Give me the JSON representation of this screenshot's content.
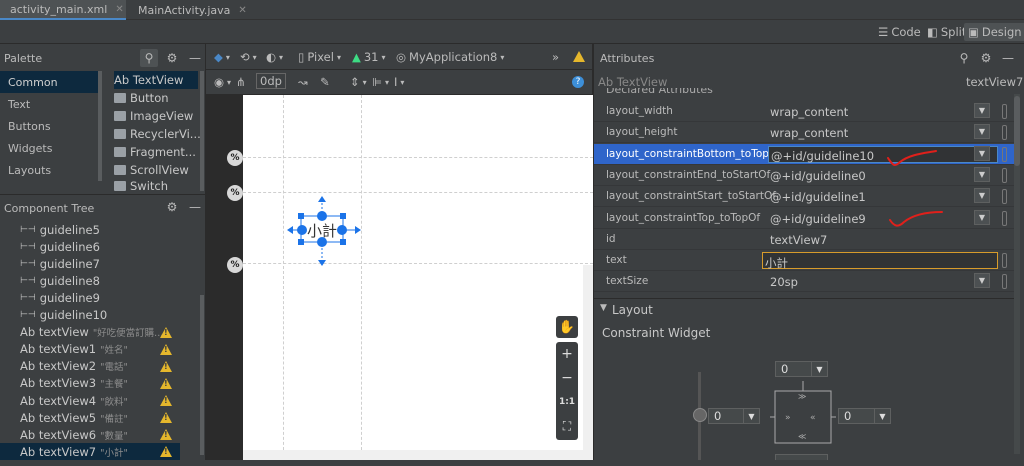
{
  "tabs": [
    {
      "label": "activity_main.xml",
      "active": true
    },
    {
      "label": "MainActivity.java",
      "active": false
    }
  ],
  "view_modes": [
    {
      "label": "Code"
    },
    {
      "label": "Split"
    },
    {
      "label": "Design",
      "active": true
    }
  ],
  "palette": {
    "title": "Palette",
    "categories": [
      "Common",
      "Text",
      "Buttons",
      "Widgets",
      "Layouts"
    ],
    "items": [
      "Ab TextView",
      "Button",
      "ImageView",
      "RecyclerVi...",
      "Fragment...",
      "ScrollView",
      "Switch"
    ]
  },
  "component_tree": {
    "title": "Component Tree",
    "items": [
      {
        "label": "guideline5",
        "sub": ""
      },
      {
        "label": "guideline6",
        "sub": ""
      },
      {
        "label": "guideline7",
        "sub": ""
      },
      {
        "label": "guideline8",
        "sub": ""
      },
      {
        "label": "guideline9",
        "sub": ""
      },
      {
        "label": "guideline10",
        "sub": ""
      },
      {
        "label": "Ab textView",
        "sub": "\"好吃便當訂購...",
        "warn": true
      },
      {
        "label": "Ab textView1",
        "sub": "\"姓名\"",
        "warn": true
      },
      {
        "label": "Ab textView2",
        "sub": "\"電話\"",
        "warn": true
      },
      {
        "label": "Ab textView3",
        "sub": "\"主餐\"",
        "warn": true
      },
      {
        "label": "Ab textView4",
        "sub": "\"飲料\"",
        "warn": true
      },
      {
        "label": "Ab textView5",
        "sub": "\"備註\"",
        "warn": true
      },
      {
        "label": "Ab textView6",
        "sub": "\"數量\"",
        "warn": true
      },
      {
        "label": "Ab textView7",
        "sub": "\"小計\"",
        "warn": true,
        "selected": true
      }
    ]
  },
  "design_toolbar": {
    "device": "Pixel",
    "api": "31",
    "theme": "MyApplication8",
    "margin": "0dp"
  },
  "canvas": {
    "selected_text": "小計",
    "percent_badge": "%",
    "zoom": {
      "plus": "+",
      "minus": "−",
      "one_to_one": "1:1"
    }
  },
  "attributes": {
    "title": "Attributes",
    "widget_type": "Ab TextView",
    "widget_id": "textView7",
    "section_partial": "Declared Attributes",
    "rows": [
      {
        "name": "layout_width",
        "value": "wrap_content",
        "dropdown": true
      },
      {
        "name": "layout_height",
        "value": "wrap_content",
        "dropdown": true
      },
      {
        "name": "layout_constraintBottom_toTopOf",
        "value": "@+id/guideline10",
        "dropdown": true,
        "selected": true
      },
      {
        "name": "layout_constraintEnd_toStartOf",
        "value": "@+id/guideline0",
        "dropdown": true
      },
      {
        "name": "layout_constraintStart_toStartOf",
        "value": "@+id/guideline1",
        "dropdown": true
      },
      {
        "name": "layout_constraintTop_toTopOf",
        "value": "@+id/guideline9",
        "dropdown": true
      },
      {
        "name": "id",
        "value": "textView7",
        "dropdown": false
      },
      {
        "name": "text",
        "value": "小計",
        "dropdown": false,
        "text_field": true
      },
      {
        "name": "textSize",
        "value": "20sp",
        "dropdown": true
      }
    ],
    "layout_section": "Layout",
    "constraint_widget": "Constraint Widget",
    "margins": {
      "top": "0",
      "left": "0",
      "right": "0"
    }
  },
  "colors": {
    "accent": "#4a88c7",
    "selection": "#2f65ca",
    "warning": "#e5b72c",
    "annotation": "#e0201b"
  }
}
